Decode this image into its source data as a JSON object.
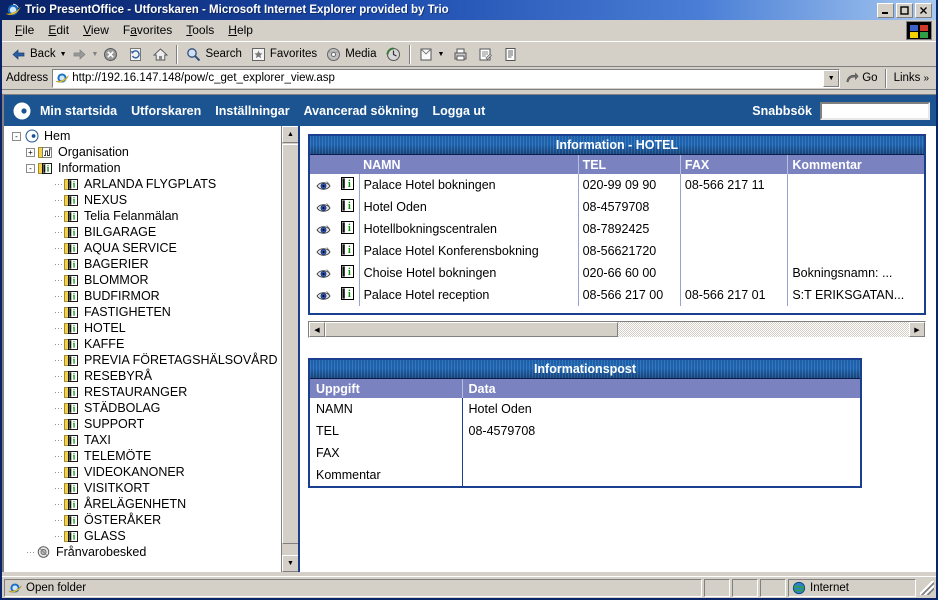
{
  "window": {
    "title": "Trio PresentOffice - Utforskaren - Microsoft Internet Explorer provided by Trio",
    "minimize_label": "_",
    "maximize_label": "□",
    "close_label": "✕"
  },
  "menubar": {
    "items": [
      {
        "label": "File",
        "accel": "F"
      },
      {
        "label": "Edit",
        "accel": "E"
      },
      {
        "label": "View",
        "accel": "V"
      },
      {
        "label": "Favorites",
        "accel": "a"
      },
      {
        "label": "Tools",
        "accel": "T"
      },
      {
        "label": "Help",
        "accel": "H"
      }
    ]
  },
  "toolbar": {
    "back": "Back",
    "forward": "",
    "stop": "",
    "refresh": "",
    "home": "",
    "search": "Search",
    "favorites": "Favorites",
    "media": "Media",
    "history": "",
    "mail": "",
    "print": "",
    "edit": "",
    "discuss": ""
  },
  "address": {
    "label": "Address",
    "url": "http://192.16.147.148/pow/c_get_explorer_view.asp",
    "go_label": "Go",
    "links_label": "Links",
    "links_chevron": "»"
  },
  "appnav": {
    "items": [
      {
        "label": "Min startsida"
      },
      {
        "label": "Utforskaren"
      },
      {
        "label": "Inställningar"
      },
      {
        "label": "Avancerad sökning"
      },
      {
        "label": "Logga ut"
      }
    ],
    "quicksearch_label": "Snabbsök",
    "quicksearch_value": "",
    "quicksearch_placeholder": ""
  },
  "tree": {
    "nodes": [
      {
        "label": "Hem",
        "level": 1,
        "toggle": "-",
        "icon": "home-globe-icon"
      },
      {
        "label": "Organisation",
        "level": 2,
        "toggle": "+",
        "icon": "org-folder-icon"
      },
      {
        "label": "Information",
        "level": 2,
        "toggle": "-",
        "icon": "info-folder-icon"
      },
      {
        "label": "ARLANDA FLYGPLATS",
        "level": 3,
        "toggle": "",
        "icon": "info-folder-icon"
      },
      {
        "label": "NEXUS",
        "level": 3,
        "toggle": "",
        "icon": "info-folder-icon"
      },
      {
        "label": "Telia Felanmälan",
        "level": 3,
        "toggle": "",
        "icon": "info-folder-icon"
      },
      {
        "label": "BILGARAGE",
        "level": 3,
        "toggle": "",
        "icon": "info-folder-icon"
      },
      {
        "label": "AQUA SERVICE",
        "level": 3,
        "toggle": "",
        "icon": "info-folder-icon"
      },
      {
        "label": "BAGERIER",
        "level": 3,
        "toggle": "",
        "icon": "info-folder-icon"
      },
      {
        "label": "BLOMMOR",
        "level": 3,
        "toggle": "",
        "icon": "info-folder-icon"
      },
      {
        "label": "BUDFIRMOR",
        "level": 3,
        "toggle": "",
        "icon": "info-folder-icon"
      },
      {
        "label": "FASTIGHETEN",
        "level": 3,
        "toggle": "",
        "icon": "info-folder-icon"
      },
      {
        "label": "HOTEL",
        "level": 3,
        "toggle": "",
        "icon": "info-folder-icon"
      },
      {
        "label": "KAFFE",
        "level": 3,
        "toggle": "",
        "icon": "info-folder-icon"
      },
      {
        "label": "PREVIA FÖRETAGSHÄLSOVÅRD",
        "level": 3,
        "toggle": "",
        "icon": "info-folder-icon"
      },
      {
        "label": "RESEBYRÅ",
        "level": 3,
        "toggle": "",
        "icon": "info-folder-icon"
      },
      {
        "label": "RESTAURANGER",
        "level": 3,
        "toggle": "",
        "icon": "info-folder-icon"
      },
      {
        "label": "STÄDBOLAG",
        "level": 3,
        "toggle": "",
        "icon": "info-folder-icon"
      },
      {
        "label": "SUPPORT",
        "level": 3,
        "toggle": "",
        "icon": "info-folder-icon"
      },
      {
        "label": "TAXI",
        "level": 3,
        "toggle": "",
        "icon": "info-folder-icon"
      },
      {
        "label": "TELEMÖTE",
        "level": 3,
        "toggle": "",
        "icon": "info-folder-icon"
      },
      {
        "label": "VIDEOKANONER",
        "level": 3,
        "toggle": "",
        "icon": "info-folder-icon"
      },
      {
        "label": "VISITKORT",
        "level": 3,
        "toggle": "",
        "icon": "info-folder-icon"
      },
      {
        "label": "ÅRELÄGENHETN",
        "level": 3,
        "toggle": "",
        "icon": "info-folder-icon"
      },
      {
        "label": "ÖSTERÅKER",
        "level": 3,
        "toggle": "",
        "icon": "info-folder-icon"
      },
      {
        "label": "GLASS",
        "level": 3,
        "toggle": "",
        "icon": "info-folder-icon"
      },
      {
        "label": "Frånvarobesked",
        "level": 2,
        "toggle": "",
        "icon": "absence-icon"
      }
    ]
  },
  "information_panel": {
    "title": "Information - HOTEL",
    "columns": [
      "",
      "",
      "NAMN",
      "TEL",
      "FAX",
      "Kommentar"
    ],
    "rows": [
      {
        "namn": "Palace Hotel bokningen",
        "tel": "020-99 09 90",
        "fax": "08-566 217 11",
        "kommentar": ""
      },
      {
        "namn": "Hotel Oden",
        "tel": "08-4579708",
        "fax": "",
        "kommentar": ""
      },
      {
        "namn": "Hotellbokningscentralen",
        "tel": "08-7892425",
        "fax": "",
        "kommentar": ""
      },
      {
        "namn": "Palace Hotel Konferensbokning",
        "tel": "08-56621720",
        "fax": "",
        "kommentar": ""
      },
      {
        "namn": "Choise Hotel bokningen",
        "tel": "020-66 60 00",
        "fax": "",
        "kommentar": "Bokningsnamn: ..."
      },
      {
        "namn": "Palace Hotel reception",
        "tel": "08-566 217 00",
        "fax": "08-566 217 01",
        "kommentar": "S:T ERIKSGATAN..."
      }
    ],
    "row_icons": {
      "view": "eye-icon",
      "info": "info-icon"
    }
  },
  "post_panel": {
    "title": "Informationspost",
    "columns": [
      "Uppgift",
      "Data"
    ],
    "rows": [
      {
        "uppgift": "NAMN",
        "data": "Hotel Oden"
      },
      {
        "uppgift": "TEL",
        "data": "08-4579708"
      },
      {
        "uppgift": "FAX",
        "data": ""
      },
      {
        "uppgift": "Kommentar",
        "data": ""
      }
    ]
  },
  "statusbar": {
    "message": "Open folder",
    "zone": "Internet"
  },
  "colors": {
    "titlebar_start": "#0a246a",
    "app_nav_bg": "#1b5490",
    "panel_border": "#1b3f8f",
    "panel_title_bg": "#1b5fa8",
    "table_header_bg": "#7b82c0",
    "chrome_bg": "#d4d0c8"
  }
}
